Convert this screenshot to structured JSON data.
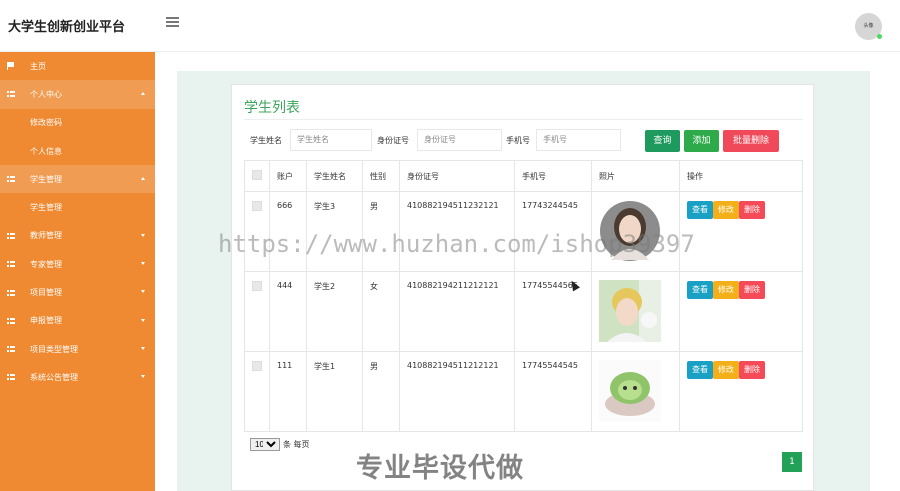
{
  "app": {
    "title": "大学生创新创业平台",
    "avatar_label": "头像"
  },
  "sidebar": {
    "items": [
      {
        "label": "主页",
        "icon": "flag-icon",
        "type": "top"
      },
      {
        "label": "个人中心",
        "icon": "grid-icon",
        "type": "group",
        "expanded": true
      },
      {
        "label": "修改密码",
        "type": "sub"
      },
      {
        "label": "个人信息",
        "type": "sub"
      },
      {
        "label": "学生管理",
        "icon": "grid-icon",
        "type": "group",
        "expanded": true
      },
      {
        "label": "学生管理",
        "type": "sub"
      },
      {
        "label": "教师管理",
        "icon": "grid-icon",
        "type": "group",
        "expanded": false
      },
      {
        "label": "专家管理",
        "icon": "grid-icon",
        "type": "group",
        "expanded": false
      },
      {
        "label": "项目管理",
        "icon": "grid-icon",
        "type": "group",
        "expanded": false
      },
      {
        "label": "申报管理",
        "icon": "grid-icon",
        "type": "group",
        "expanded": false
      },
      {
        "label": "项目类型管理",
        "icon": "grid-icon",
        "type": "group",
        "expanded": false
      },
      {
        "label": "系统公告管理",
        "icon": "grid-icon",
        "type": "group",
        "expanded": false
      }
    ]
  },
  "page": {
    "title": "学生列表"
  },
  "search": {
    "name_label": "学生姓名",
    "name_placeholder": "学生姓名",
    "id_label": "身份证号",
    "id_placeholder": "身份证号",
    "phone_label": "手机号",
    "phone_placeholder": "手机号",
    "query_label": "查询",
    "add_label": "添加",
    "batch_delete_label": "批量删除"
  },
  "table": {
    "headers": [
      "账户",
      "学生姓名",
      "性别",
      "身份证号",
      "手机号",
      "照片",
      "操作"
    ],
    "rows": [
      {
        "account": "666",
        "name": "学生3",
        "gender": "男",
        "id_number": "410882194511232121",
        "phone": "17743244545"
      },
      {
        "account": "444",
        "name": "学生2",
        "gender": "女",
        "id_number": "410882194211212121",
        "phone": "17745544565"
      },
      {
        "account": "111",
        "name": "学生1",
        "gender": "男",
        "id_number": "410882194511212121",
        "phone": "17745544545"
      }
    ],
    "view_label": "查看",
    "edit_label": "修改",
    "delete_label": "删除"
  },
  "pager": {
    "page_size": "10",
    "per_page_label": "条 每页",
    "current_page": "1"
  },
  "overlay": {
    "watermark": "https://www.huzhan.com/ishop39397",
    "bottom_text": "专业毕设代做"
  },
  "colors": {
    "sidebar": "#ef8a32",
    "query": "#1f9a5e",
    "add": "#2eaa4a",
    "batch_delete": "#f04a5a",
    "view": "#1aa0c4",
    "edit": "#f3b01b",
    "delete": "#f54a57"
  }
}
